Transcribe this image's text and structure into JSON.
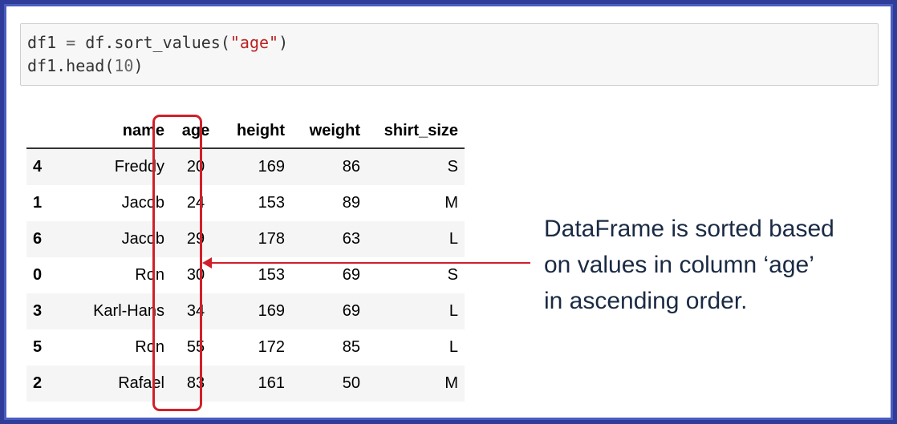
{
  "code": {
    "line1": {
      "var": "df1",
      "op": " = ",
      "call": "df.sort_values(",
      "arg": "\"age\"",
      "close": ")"
    },
    "line2": {
      "call": "df1.head(",
      "arg": "10",
      "close": ")"
    }
  },
  "table": {
    "columns": [
      "",
      "name",
      "age",
      "height",
      "weight",
      "shirt_size"
    ],
    "rows": [
      {
        "index": "4",
        "name": "Freddy",
        "age": "20",
        "height": "169",
        "weight": "86",
        "shirt_size": "S"
      },
      {
        "index": "1",
        "name": "Jacob",
        "age": "24",
        "height": "153",
        "weight": "89",
        "shirt_size": "M"
      },
      {
        "index": "6",
        "name": "Jacob",
        "age": "29",
        "height": "178",
        "weight": "63",
        "shirt_size": "L"
      },
      {
        "index": "0",
        "name": "Ron",
        "age": "30",
        "height": "153",
        "weight": "69",
        "shirt_size": "S"
      },
      {
        "index": "3",
        "name": "Karl-Hans",
        "age": "34",
        "height": "169",
        "weight": "69",
        "shirt_size": "L"
      },
      {
        "index": "5",
        "name": "Ron",
        "age": "55",
        "height": "172",
        "weight": "85",
        "shirt_size": "L"
      },
      {
        "index": "2",
        "name": "Rafael",
        "age": "83",
        "height": "161",
        "weight": "50",
        "shirt_size": "M"
      }
    ]
  },
  "annotation": {
    "line1": "DataFrame is sorted based",
    "line2": "on values in column ‘age’",
    "line3": "in ascending order."
  },
  "colors": {
    "frame_border": "#2f3c9a",
    "highlight": "#d0202a",
    "annotation_text": "#1a2a44"
  }
}
